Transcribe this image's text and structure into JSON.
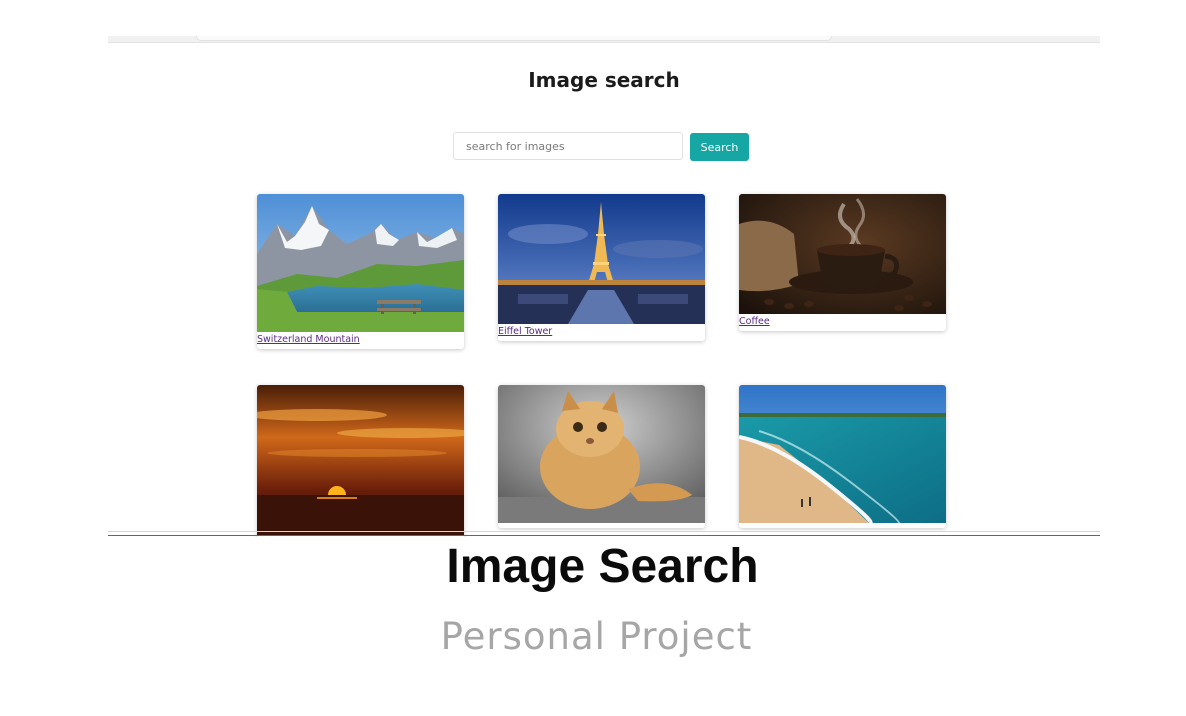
{
  "app": {
    "title": "Image search",
    "search": {
      "placeholder": "search for images",
      "value": ""
    },
    "search_button_label": "Search",
    "results": [
      {
        "label": "Switzerland Mountain",
        "image": "mountain-lake-photo"
      },
      {
        "label": "Eiffel Tower",
        "image": "eiffel-tower-night-photo"
      },
      {
        "label": "Coffee",
        "image": "coffee-cup-photo"
      },
      {
        "label": "",
        "image": "sunset-over-sea-photo"
      },
      {
        "label": "",
        "image": "persian-cat-photo"
      },
      {
        "label": "",
        "image": "beach-coastline-photo"
      }
    ]
  },
  "caption": {
    "title": "Image Search",
    "subtitle": "Personal Project"
  },
  "colors": {
    "accent": "#16a6a4",
    "link": "#5b2a86",
    "subtitle": "#a6a6a6"
  }
}
